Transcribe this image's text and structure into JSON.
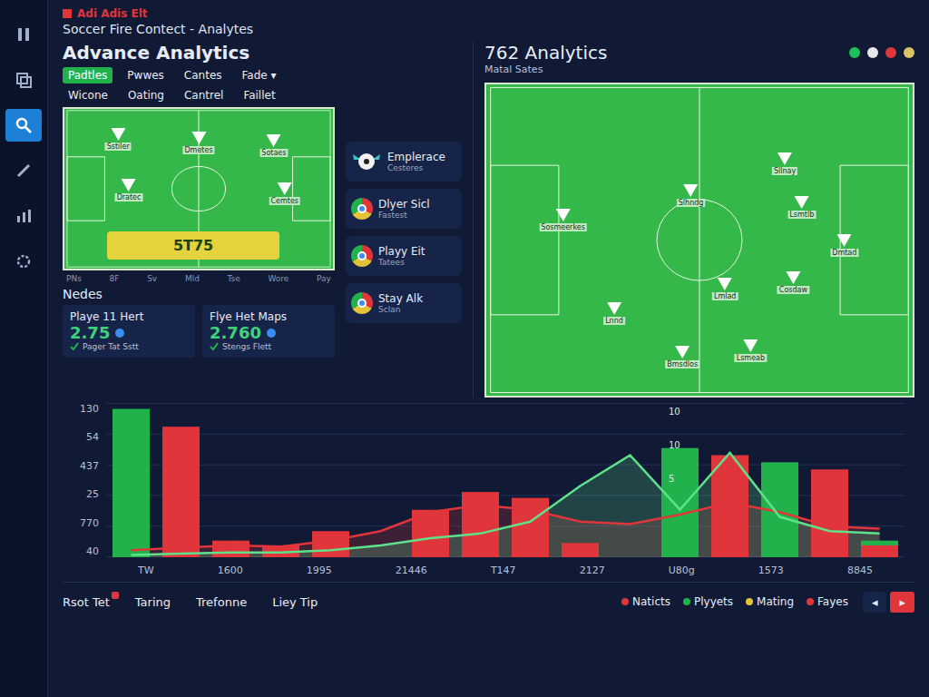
{
  "window": {
    "badge": "Adi Adis Elt",
    "title": "Soccer Fire Contect - Analytes"
  },
  "sidebar": {
    "items": [
      {
        "kind": "pause",
        "selected": false
      },
      {
        "kind": "layers",
        "selected": false
      },
      {
        "kind": "search",
        "selected": true
      },
      {
        "kind": "edit",
        "selected": false
      },
      {
        "kind": "chart",
        "selected": false
      },
      {
        "kind": "settings",
        "selected": false
      }
    ]
  },
  "left_panel": {
    "title": "Advance Analytics",
    "tabs": [
      {
        "label": "Padtles",
        "selected": true
      },
      {
        "label": "Pwwes",
        "selected": false
      },
      {
        "label": "Cantes",
        "selected": false
      },
      {
        "label": "Fade ▾",
        "selected": false
      },
      {
        "label": "Wicone",
        "selected": false
      },
      {
        "label": "Oating",
        "selected": false
      },
      {
        "label": "Cantrel",
        "selected": false
      },
      {
        "label": "Faillet",
        "selected": false
      }
    ],
    "pitch": {
      "markers": [
        "Sstiler",
        "Dmetes",
        "Sotaes",
        "Dratec",
        "Cemtes"
      ],
      "badge": "5T75",
      "axis": [
        "PNs",
        "8F",
        "Sv",
        "Mld",
        "Tse",
        "Wore",
        "Pay"
      ]
    },
    "section_title": "Nedes",
    "cards": [
      {
        "title": "Playe 11 Hert",
        "value": "2.75",
        "caption": "Pager Tat Sstt"
      },
      {
        "title": "Flye Het Maps",
        "value": "2.760",
        "caption": "Stengs Flett"
      }
    ]
  },
  "apps": [
    {
      "kind": "ball",
      "title": "Emplerace",
      "caption": "Cesteres"
    },
    {
      "kind": "browser",
      "title": "Dlyer Sicl",
      "caption": "Fastest"
    },
    {
      "kind": "browser",
      "title": "Playy Eit",
      "caption": "Tatees"
    },
    {
      "kind": "browser",
      "title": "Stay Alk",
      "caption": "Sclan"
    }
  ],
  "right_panel": {
    "title": "762 Analytics",
    "subtitle": "Matal Sates",
    "status": [
      {
        "color": "#1fbf5a"
      },
      {
        "color": "#e8e8e8"
      },
      {
        "color": "#e0353b"
      },
      {
        "color": "#d9c46a"
      }
    ],
    "markers": [
      "Sosmeerkes",
      "Slhndg",
      "Sllnay",
      "Lsmtlb",
      "Lmlad",
      "Lnnd",
      "Cosdaw",
      "Bmsdlos",
      "Dmtad",
      "Lsmeab"
    ]
  },
  "chart": {
    "y_ticks": [
      "130",
      "54",
      "437",
      "25",
      "770",
      "40"
    ],
    "x_labels": [
      "TW",
      "1600",
      "1995",
      "21446",
      "T147",
      "2127",
      "U80g",
      "1573",
      "8845"
    ],
    "overlay_ticks": [
      "10",
      "10",
      "5"
    ],
    "series": [
      {
        "kind": "bar",
        "color": "#22b24c",
        "values": [
          125,
          0,
          0,
          0,
          0,
          0,
          0,
          0,
          0,
          0,
          0,
          92,
          0,
          80,
          0,
          14
        ]
      },
      {
        "kind": "bar",
        "color": "#e0353b",
        "values": [
          0,
          110,
          14,
          10,
          22,
          0,
          40,
          55,
          50,
          12,
          0,
          0,
          86,
          0,
          74,
          10
        ]
      },
      {
        "kind": "line",
        "color": "#e0353b",
        "values": [
          6,
          8,
          10,
          9,
          14,
          22,
          38,
          44,
          40,
          30,
          28,
          36,
          46,
          38,
          26,
          24
        ]
      },
      {
        "kind": "line",
        "color": "#5fe08a",
        "values": [
          2,
          3,
          4,
          4,
          6,
          10,
          16,
          20,
          30,
          60,
          86,
          40,
          88,
          34,
          22,
          20
        ]
      }
    ]
  },
  "footer": {
    "items": [
      {
        "label": "Rsot Tet",
        "badge": true
      },
      {
        "label": "Taring",
        "badge": false
      },
      {
        "label": "Trefonne",
        "badge": false
      },
      {
        "label": "Liey Tip",
        "badge": false
      }
    ],
    "legend": [
      {
        "label": "Naticts",
        "color": "#e0353b"
      },
      {
        "label": "Plyyets",
        "color": "#22b24c"
      },
      {
        "label": "Mating",
        "color": "#e3c23a"
      },
      {
        "label": "Fayes",
        "color": "#e0353b"
      }
    ],
    "pager_prev": "◂",
    "pager_next": "▸"
  }
}
